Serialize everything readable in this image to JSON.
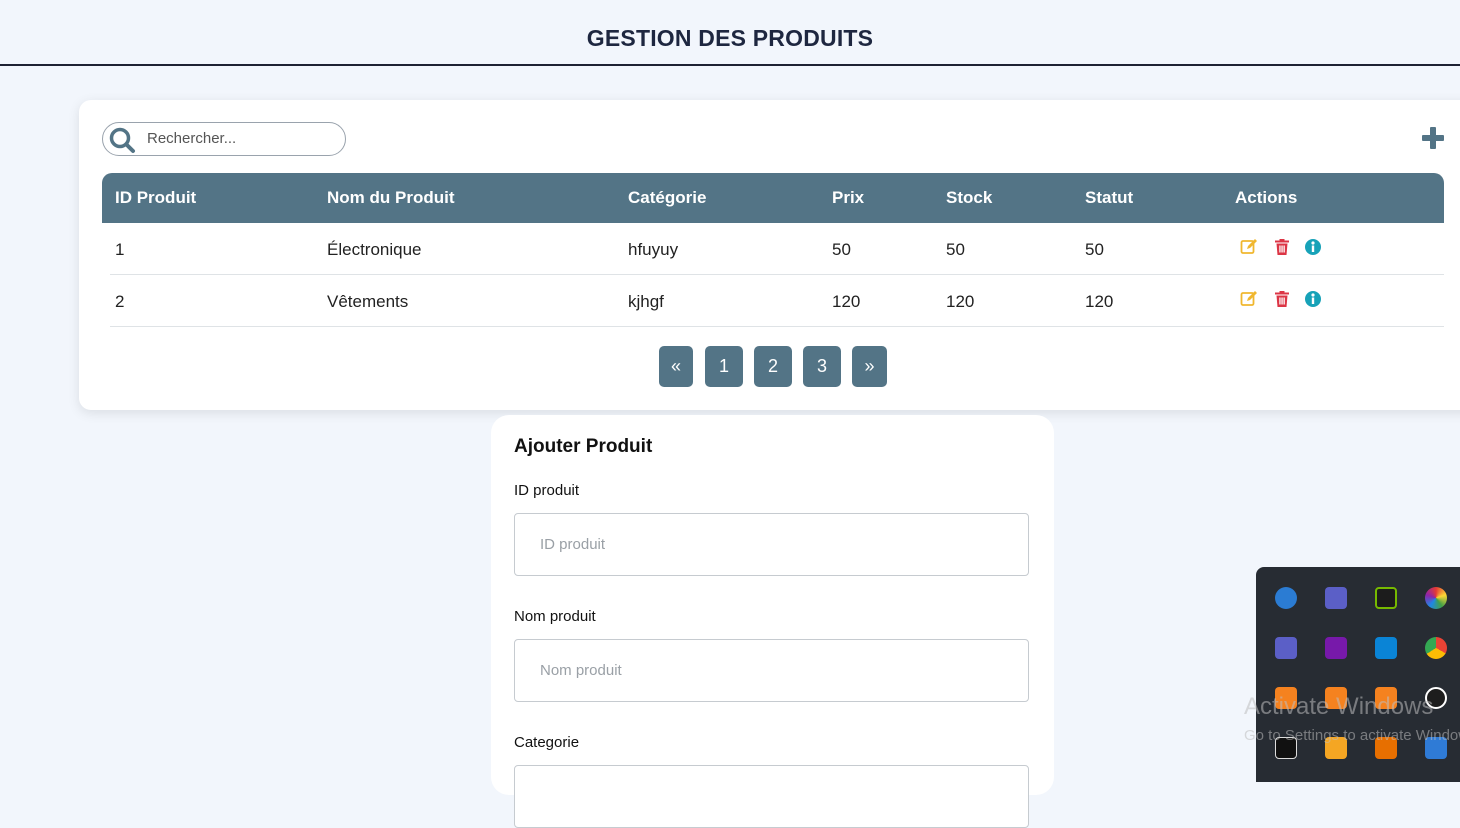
{
  "header": {
    "title": "GESTION DES PRODUITS"
  },
  "search": {
    "placeholder": "Rechercher..."
  },
  "table": {
    "columns": [
      "ID Produit",
      "Nom du Produit",
      "Catégorie",
      "Prix",
      "Stock",
      "Statut",
      "Actions"
    ],
    "rows": [
      [
        "1",
        "Électronique",
        "hfuyuy",
        "50",
        "50",
        "50"
      ],
      [
        "2",
        "Vêtements",
        "kjhgf",
        "120",
        "120",
        "120"
      ]
    ]
  },
  "pagination": {
    "prev": "«",
    "pages": [
      "1",
      "2",
      "3"
    ],
    "next": "»"
  },
  "form": {
    "title": "Ajouter Produit",
    "fields": [
      {
        "label": "ID produit",
        "placeholder": "ID produit"
      },
      {
        "label": "Nom produit",
        "placeholder": "Nom produit"
      },
      {
        "label": "Categorie",
        "placeholder": ""
      }
    ]
  },
  "icons": {
    "search": "search-icon",
    "add": "plus-icon",
    "edit": "edit-icon",
    "delete": "trash-icon",
    "info": "info-icon"
  },
  "colors": {
    "accent": "#537486",
    "edit": "#f0b72f",
    "delete": "#dc3545",
    "info": "#17a2b8",
    "title": "#1e2740"
  },
  "tray_icons": [
    "onedrive-icon",
    "teams-icon",
    "nvidia-icon",
    "color-icon",
    "teams-icon",
    "onenote-icon",
    "store-icon",
    "chrome-icon",
    "xampp-icon",
    "xampp-icon",
    "xampp-icon",
    "teamviewer-icon",
    "epic-games-icon",
    "app-icon",
    "java-icon",
    "windows-security-icon"
  ],
  "watermark": {
    "line1": "Activate Windows",
    "line2": "Go to Settings to activate Windows."
  }
}
